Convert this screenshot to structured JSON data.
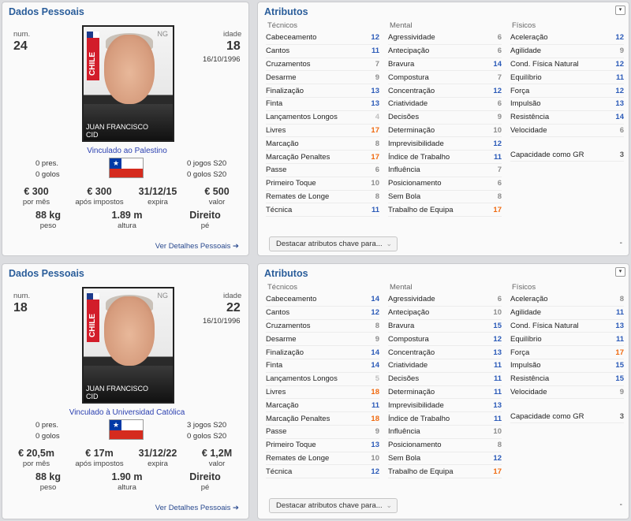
{
  "labels": {
    "personal_title": "Dados Pessoais",
    "attributes_title": "Atributos",
    "num": "num.",
    "idade": "idade",
    "por_mes": "por mês",
    "apos_impostos": "após impostos",
    "expira": "expira",
    "valor": "valor",
    "peso": "peso",
    "altura": "altura",
    "pe": "pé",
    "details_link": "Ver Detalhes Pessoais",
    "arrow": "➔",
    "tecnicos": "Técnicos",
    "mental": "Mental",
    "fisicos": "Físicos",
    "gk": "Capacidade como GR",
    "dropdown": "Destacar atributos chave para...",
    "dropdown_chevron": "⌄",
    "menu_chevron": "▾",
    "dash": "-",
    "ng": "NG",
    "country_strip": "CHILE",
    "flag_star": "★",
    "photo_name_line1": "JUAN FRANCISCO",
    "photo_name_line2": "CID"
  },
  "players": [
    {
      "num": "24",
      "idade": "18",
      "dob": "16/10/1996",
      "club": "Vinculado ao Palestino",
      "pres": "0 pres.",
      "golos": "0 golos",
      "jogos_s20": "0 jogos S20",
      "golos_s20": "0 golos S20",
      "wage": "€ 300",
      "after_tax": "€ 300",
      "expires": "31/12/15",
      "value": "€ 500",
      "weight": "88 kg",
      "height": "1.89 m",
      "foot": "Direito",
      "tecnicos": [
        {
          "name": "Cabeceamento",
          "v": "12"
        },
        {
          "name": "Cantos",
          "v": "11"
        },
        {
          "name": "Cruzamentos",
          "v": "7"
        },
        {
          "name": "Desarme",
          "v": "9"
        },
        {
          "name": "Finalização",
          "v": "13"
        },
        {
          "name": "Finta",
          "v": "13"
        },
        {
          "name": "Lançamentos Longos",
          "v": "4"
        },
        {
          "name": "Livres",
          "v": "17"
        },
        {
          "name": "Marcação",
          "v": "8"
        },
        {
          "name": "Marcação Penaltes",
          "v": "17"
        },
        {
          "name": "Passe",
          "v": "6"
        },
        {
          "name": "Primeiro Toque",
          "v": "10"
        },
        {
          "name": "Remates de Longe",
          "v": "8"
        },
        {
          "name": "Técnica",
          "v": "11"
        }
      ],
      "mental": [
        {
          "name": "Agressividade",
          "v": "6"
        },
        {
          "name": "Antecipação",
          "v": "6"
        },
        {
          "name": "Bravura",
          "v": "14"
        },
        {
          "name": "Compostura",
          "v": "7"
        },
        {
          "name": "Concentração",
          "v": "12"
        },
        {
          "name": "Criatividade",
          "v": "6"
        },
        {
          "name": "Decisões",
          "v": "9"
        },
        {
          "name": "Determinação",
          "v": "10"
        },
        {
          "name": "Imprevisibilidade",
          "v": "12"
        },
        {
          "name": "Índice de Trabalho",
          "v": "11"
        },
        {
          "name": "Influência",
          "v": "7"
        },
        {
          "name": "Posicionamento",
          "v": "6"
        },
        {
          "name": "Sem Bola",
          "v": "8"
        },
        {
          "name": "Trabalho de Equipa",
          "v": "17"
        }
      ],
      "fisicos": [
        {
          "name": "Aceleração",
          "v": "12"
        },
        {
          "name": "Agilidade",
          "v": "9"
        },
        {
          "name": "Cond. Física Natural",
          "v": "12"
        },
        {
          "name": "Equilíbrio",
          "v": "11"
        },
        {
          "name": "Força",
          "v": "12"
        },
        {
          "name": "Impulsão",
          "v": "13"
        },
        {
          "name": "Resistência",
          "v": "14"
        },
        {
          "name": "Velocidade",
          "v": "6"
        }
      ],
      "gk": "3"
    },
    {
      "num": "18",
      "idade": "22",
      "dob": "16/10/1996",
      "club": "Vinculado à Universidad Católica",
      "pres": "0 pres.",
      "golos": "0 golos",
      "jogos_s20": "3 jogos S20",
      "golos_s20": "0 golos S20",
      "wage": "€ 20,5m",
      "after_tax": "€ 17m",
      "expires": "31/12/22",
      "value": "€ 1,2M",
      "weight": "88 kg",
      "height": "1.90 m",
      "foot": "Direito",
      "tecnicos": [
        {
          "name": "Cabeceamento",
          "v": "14"
        },
        {
          "name": "Cantos",
          "v": "12"
        },
        {
          "name": "Cruzamentos",
          "v": "8"
        },
        {
          "name": "Desarme",
          "v": "9"
        },
        {
          "name": "Finalização",
          "v": "14"
        },
        {
          "name": "Finta",
          "v": "14"
        },
        {
          "name": "Lançamentos Longos",
          "v": "5"
        },
        {
          "name": "Livres",
          "v": "18"
        },
        {
          "name": "Marcação",
          "v": "11"
        },
        {
          "name": "Marcação Penaltes",
          "v": "18"
        },
        {
          "name": "Passe",
          "v": "9"
        },
        {
          "name": "Primeiro Toque",
          "v": "13"
        },
        {
          "name": "Remates de Longe",
          "v": "10"
        },
        {
          "name": "Técnica",
          "v": "12"
        }
      ],
      "mental": [
        {
          "name": "Agressividade",
          "v": "6"
        },
        {
          "name": "Antecipação",
          "v": "10"
        },
        {
          "name": "Bravura",
          "v": "15"
        },
        {
          "name": "Compostura",
          "v": "12"
        },
        {
          "name": "Concentração",
          "v": "13"
        },
        {
          "name": "Criatividade",
          "v": "11"
        },
        {
          "name": "Decisões",
          "v": "11"
        },
        {
          "name": "Determinação",
          "v": "11"
        },
        {
          "name": "Imprevisibilidade",
          "v": "13"
        },
        {
          "name": "Índice de Trabalho",
          "v": "11"
        },
        {
          "name": "Influência",
          "v": "10"
        },
        {
          "name": "Posicionamento",
          "v": "8"
        },
        {
          "name": "Sem Bola",
          "v": "12"
        },
        {
          "name": "Trabalho de Equipa",
          "v": "17"
        }
      ],
      "fisicos": [
        {
          "name": "Aceleração",
          "v": "8"
        },
        {
          "name": "Agilidade",
          "v": "11"
        },
        {
          "name": "Cond. Física Natural",
          "v": "13"
        },
        {
          "name": "Equilíbrio",
          "v": "11"
        },
        {
          "name": "Força",
          "v": "17"
        },
        {
          "name": "Impulsão",
          "v": "15"
        },
        {
          "name": "Resistência",
          "v": "15"
        },
        {
          "name": "Velocidade",
          "v": "9"
        }
      ],
      "gk": "3"
    }
  ]
}
